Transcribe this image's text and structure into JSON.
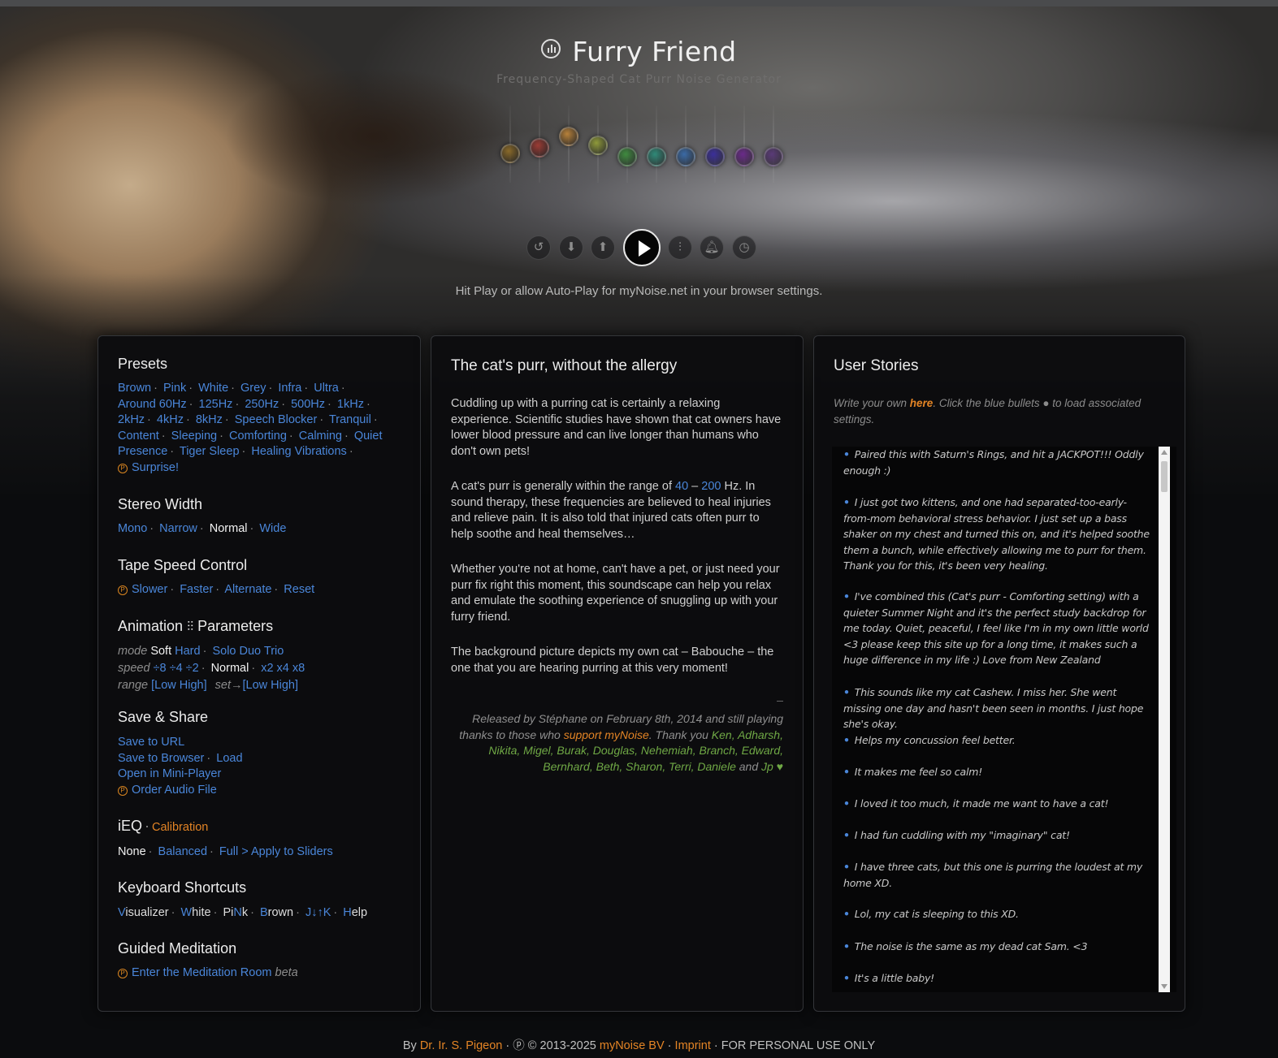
{
  "header": {
    "title": "Furry Friend",
    "subtitle": "Frequency-Shaped Cat Purr Noise Generator",
    "title_icon": "equalizer-circle-icon",
    "autoplay_hint": "Hit Play or allow Auto-Play for myNoise.net in your browser settings."
  },
  "equalizer": {
    "knob_colors": [
      "#8a6a2a",
      "#9b3b34",
      "#b7813a",
      "#8f9a3a",
      "#3f8b3f",
      "#2f8a78",
      "#3a6aa6",
      "#3b2f9a",
      "#6a2a8a",
      "#5a3a78"
    ],
    "levels": [
      0.25,
      0.35,
      0.55,
      0.4,
      0.2,
      0.2,
      0.2,
      0.2,
      0.2,
      0.2
    ]
  },
  "controls": {
    "icons": [
      "undo-icon",
      "download-icon",
      "upload-icon",
      "play-icon",
      "sliders-icon",
      "bell-icon",
      "timer-icon"
    ]
  },
  "presets": {
    "title": "Presets",
    "row1": [
      "Brown",
      "Pink",
      "White",
      "Grey",
      "Infra",
      "Ultra"
    ],
    "row2": [
      "Around 60Hz",
      "125Hz",
      "250Hz",
      "500Hz",
      "1kHz"
    ],
    "row3": [
      "2kHz",
      "4kHz",
      "8kHz",
      "Speech Blocker",
      "Tranquil"
    ],
    "row4": [
      "Content",
      "Sleeping",
      "Comforting",
      "Calming",
      "Quiet"
    ],
    "row5": [
      "Presence",
      "Tiger Sleep",
      "Healing Vibrations"
    ],
    "surprise": "Surprise!"
  },
  "stereo": {
    "title": "Stereo Width",
    "mono": "Mono",
    "narrow": "Narrow",
    "normal": "Normal",
    "wide": "Wide"
  },
  "tape": {
    "title": "Tape Speed Control",
    "slower": "Slower",
    "faster": "Faster",
    "alternate": "Alternate",
    "reset": "Reset"
  },
  "animation": {
    "title_a": "Animation",
    "title_b": "Parameters",
    "mode_label": "mode",
    "soft": "Soft",
    "hard": "Hard",
    "solo": "Solo",
    "duo": "Duo",
    "trio": "Trio",
    "speed_label": "speed",
    "d8": "÷8",
    "d4": "÷4",
    "d2": "÷2",
    "normal": "Normal",
    "x2": "x2",
    "x4": "x4",
    "x8": "x8",
    "range_label": "range",
    "range1": "[Low High]",
    "set_label": "set→",
    "range2": "[Low High]"
  },
  "save_share": {
    "title": "Save & Share",
    "save_url": "Save to URL",
    "save_browser": "Save to Browser",
    "load": "Load",
    "mini_player": "Open in Mini-Player",
    "order_audio": "Order Audio File"
  },
  "ieq": {
    "title": "iEQ",
    "calibration": "Calibration",
    "none": "None",
    "balanced": "Balanced",
    "full": "Full",
    "apply": "> Apply to Sliders"
  },
  "shortcuts": {
    "title": "Keyboard Shortcuts",
    "visualizer_key": "V",
    "visualizer_rest": "isualizer",
    "white_key": "W",
    "white_rest": "hite",
    "pink_pre": "Pi",
    "pink_key": "N",
    "pink_post": "k",
    "brown_key": "B",
    "brown_rest": "rown",
    "arrows": "J↓↑K",
    "help_key": "H",
    "help_rest": "elp"
  },
  "meditation": {
    "title": "Guided Meditation",
    "link": "Enter the Meditation Room",
    "badge": "beta"
  },
  "article": {
    "title": "The cat's purr, without the allergy",
    "p1": "Cuddling up with a purring cat is certainly a relaxing experience. Scientific studies have shown that cat owners have lower blood pressure and can live longer than humans who don't own pets!",
    "p2_a": "A cat's purr is generally within the range of ",
    "p2_low": "40",
    "p2_dash": " – ",
    "p2_high": "200",
    "p2_b": " Hz. In sound therapy, these frequencies are believed to heal injuries and relieve pain. It is also told that injured cats often purr to help soothe and heal themselves…",
    "p3": "Whether you're not at home, can't have a pet, or just need your purr fix right this moment, this soundscape can help you relax and emulate the soothing experience of snuggling up with your furry friend.",
    "p4": "The background picture depicts my own cat – Babouche – the one that you are hearing purring at this very moment!",
    "credits_a": "Released by Stéphane on February 8th, 2014 and still playing thanks to those who ",
    "credits_link": "support myNoise",
    "credits_b": ". Thank you ",
    "credits_names": "Ken, Adharsh, Nikita, Migel, Burak, Douglas, Nehemiah, Branch, Edward, Bernhard, Beth, Sharon, Terri, Daniele",
    "credits_and": " and ",
    "credits_last": "Jp",
    "heart": "♥"
  },
  "stories": {
    "title": "User Stories",
    "intro_a": "Write your own ",
    "intro_link": "here",
    "intro_b": ". Click the blue bullets ● to load associated settings.",
    "items": [
      "Paired this with Saturn's Rings, and hit a JACKPOT!!! Oddly enough :)",
      "I just got two kittens, and one had separated-too-early-from-mom behavioral stress behavior. I just set up a bass shaker on my chest and turned this on, and it's helped soothe them a bunch, while effectively allowing me to purr for them. Thank you for this, it's been very healing.",
      "I've combined this (Cat's purr - Comforting setting) with a quieter Summer Night and it's the perfect study backdrop for me today. Quiet, peaceful, I feel like I'm in my own little world <3 please keep this site up for a long time, it makes such a huge difference in my life :) Love from New Zealand",
      "This sounds like my cat Cashew. I miss her. She went missing one day and hasn't been seen in months. I just hope she's okay.",
      "Helps my concussion feel better.",
      "It makes me feel so calm!",
      "I loved it too much, it made me want to have a cat!",
      "I had fun cuddling with my \"imaginary\" cat!",
      "I have three cats, but this one is purring the loudest at my home XD.",
      "Lol, my cat is sleeping to this XD.",
      "The noise is the same as my dead cat Sam. <3",
      "It's a little baby!"
    ]
  },
  "footer": {
    "by": "By ",
    "author": "Dr. Ir. S. Pigeon",
    "mid": " · ⓟ © 2013-2025 ",
    "company": "myNoise BV",
    "sep": " · ",
    "imprint": "Imprint",
    "tail": " · FOR PERSONAL USE ONLY"
  }
}
